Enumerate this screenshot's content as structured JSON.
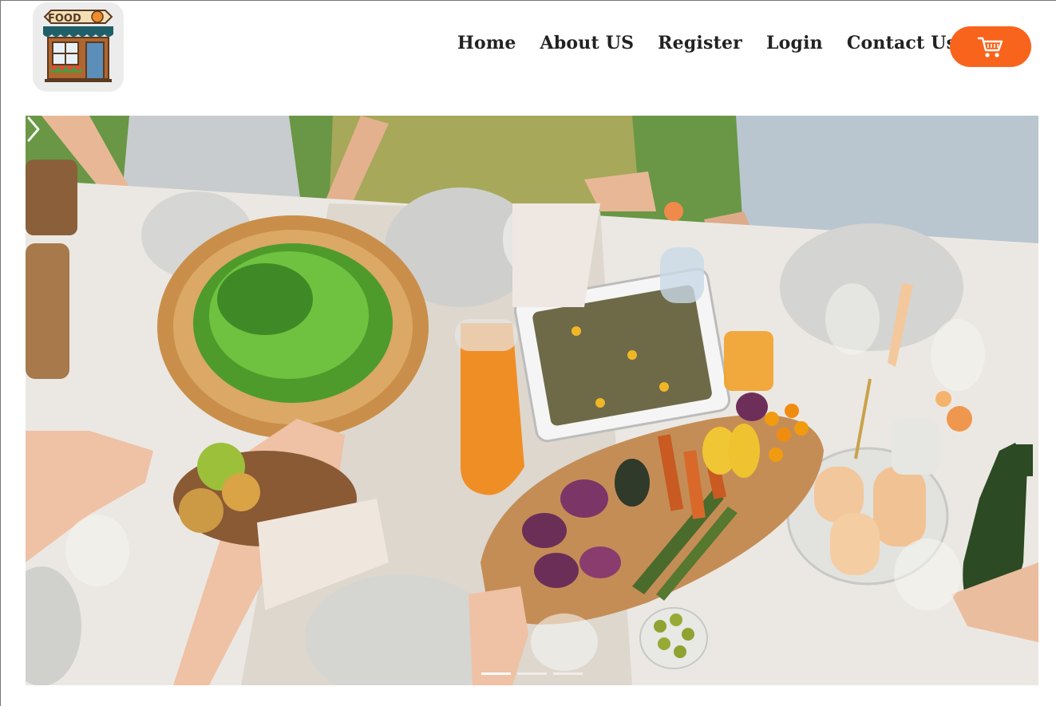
{
  "brand": {
    "logo_text": "FOOD",
    "logo_icon": "food-store-icon"
  },
  "nav": {
    "items": [
      {
        "label": "Home"
      },
      {
        "label": "About US"
      },
      {
        "label": "Register"
      },
      {
        "label": "Login"
      },
      {
        "label": "Contact Us"
      }
    ]
  },
  "cart": {
    "icon": "cart-icon",
    "color": "#f9641d"
  },
  "hero": {
    "image_subject": "dining-table-photo",
    "slides_total": 3,
    "active_slide": 1
  }
}
